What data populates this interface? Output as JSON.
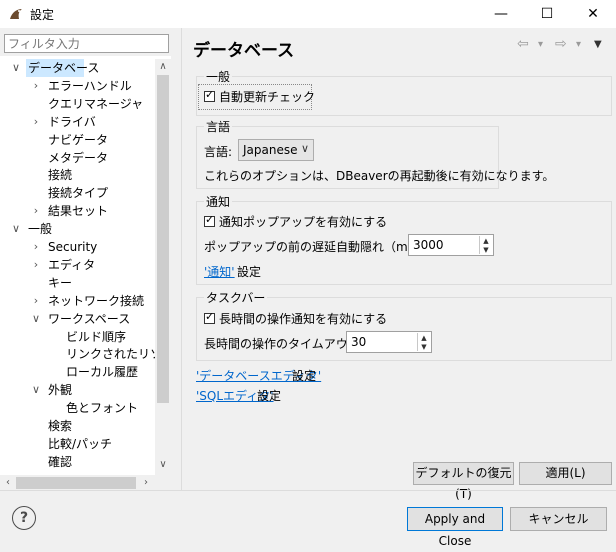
{
  "window": {
    "title": "設定",
    "minimize": "—",
    "maximize": "☐",
    "close": "✕"
  },
  "filter": {
    "placeholder": "フィルタ入力"
  },
  "tree": [
    {
      "label": "データベース",
      "arrow": "∨",
      "level": 0,
      "selected": true
    },
    {
      "label": "エラーハンドル",
      "arrow": "›",
      "level": 1
    },
    {
      "label": "クエリマネージャ",
      "arrow": "",
      "level": 1
    },
    {
      "label": "ドライバ",
      "arrow": "›",
      "level": 1
    },
    {
      "label": "ナビゲータ",
      "arrow": "",
      "level": 1
    },
    {
      "label": "メタデータ",
      "arrow": "",
      "level": 1
    },
    {
      "label": "接続",
      "arrow": "",
      "level": 1
    },
    {
      "label": "接続タイプ",
      "arrow": "",
      "level": 1
    },
    {
      "label": "結果セット",
      "arrow": "›",
      "level": 1
    },
    {
      "label": "一般",
      "arrow": "∨",
      "level": 0
    },
    {
      "label": "Security",
      "arrow": "›",
      "level": 1
    },
    {
      "label": "エディタ",
      "arrow": "›",
      "level": 1
    },
    {
      "label": "キー",
      "arrow": "",
      "level": 1
    },
    {
      "label": "ネットワーク接続",
      "arrow": "›",
      "level": 1
    },
    {
      "label": "ワークスペース",
      "arrow": "∨",
      "level": 1
    },
    {
      "label": "ビルド順序",
      "arrow": "",
      "level": 2
    },
    {
      "label": "リンクされたリソース",
      "arrow": "",
      "level": 2
    },
    {
      "label": "ローカル履歴",
      "arrow": "",
      "level": 2
    },
    {
      "label": "外観",
      "arrow": "∨",
      "level": 1
    },
    {
      "label": "色とフォント",
      "arrow": "",
      "level": 2
    },
    {
      "label": "検索",
      "arrow": "",
      "level": 1
    },
    {
      "label": "比較/パッチ",
      "arrow": "",
      "level": 1
    },
    {
      "label": "確認",
      "arrow": "",
      "level": 1
    }
  ],
  "page": {
    "title": "データベース",
    "nav_back": "⇦",
    "nav_back_menu": "▾",
    "nav_fwd": "⇨",
    "nav_fwd_menu": "▾",
    "view_menu": "▼"
  },
  "general": {
    "label": "一般",
    "auto_update": "自動更新チェック"
  },
  "language": {
    "label": "言語",
    "field_label": "言語:",
    "value": "Japanese",
    "note": "これらのオプションは、DBeaverの再起動後に有効になります。"
  },
  "notify": {
    "label": "通知",
    "enable_popup": "通知ポップアップを有効にする",
    "delay_label": "ポップアップの前の遅延自動隠れ（ms）:",
    "delay_value": "3000",
    "link": "'通知'",
    "link_suffix": "設定"
  },
  "taskbar": {
    "label": "タスクバー",
    "long_op": "長時間の操作通知を有効にする",
    "timeout_label": "長時間の操作のタイムアウト:",
    "timeout_value": "30"
  },
  "links": {
    "db_editor": "'データベースエディタ'",
    "db_editor_suffix": "設定",
    "sql_editor": "'SQLエディタ'",
    "sql_editor_suffix": "設定"
  },
  "buttons": {
    "restore": "デフォルトの復元(T)",
    "apply": "適用(L)",
    "apply_close": "Apply and Close",
    "cancel": "キャンセル",
    "help": "?"
  }
}
